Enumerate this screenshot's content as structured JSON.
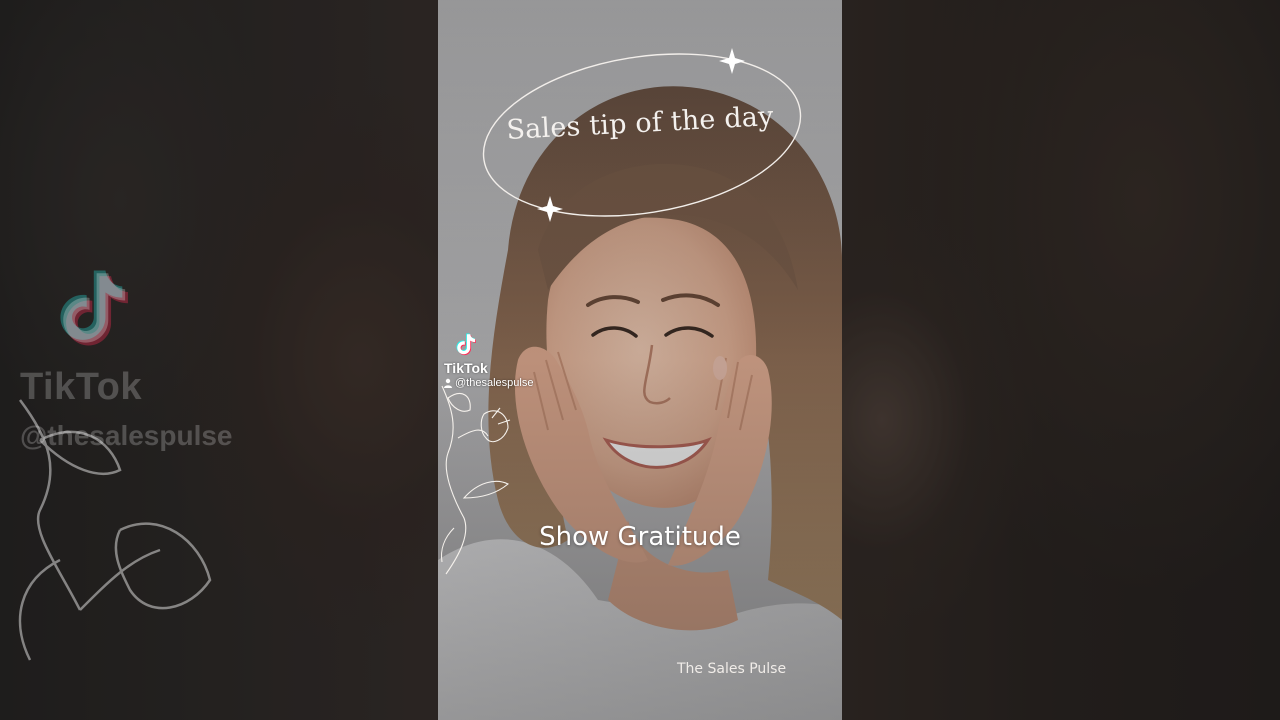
{
  "overlay": {
    "title": "Sales tip of the day",
    "tip": "Show Gratitude",
    "brand": "The Sales Pulse"
  },
  "watermark": {
    "name": "TikTok",
    "handle": "@thesalespulse",
    "logo_icon": "tiktok-logo-icon",
    "user_icon": "user-icon"
  },
  "decor": {
    "ring_color": "#f2eeea",
    "sparkle_color": "#ffffff",
    "flower_color": "#f5f1ec"
  },
  "colors": {
    "tiktok_cyan": "#25f4ee",
    "tiktok_red": "#fe2c55"
  }
}
